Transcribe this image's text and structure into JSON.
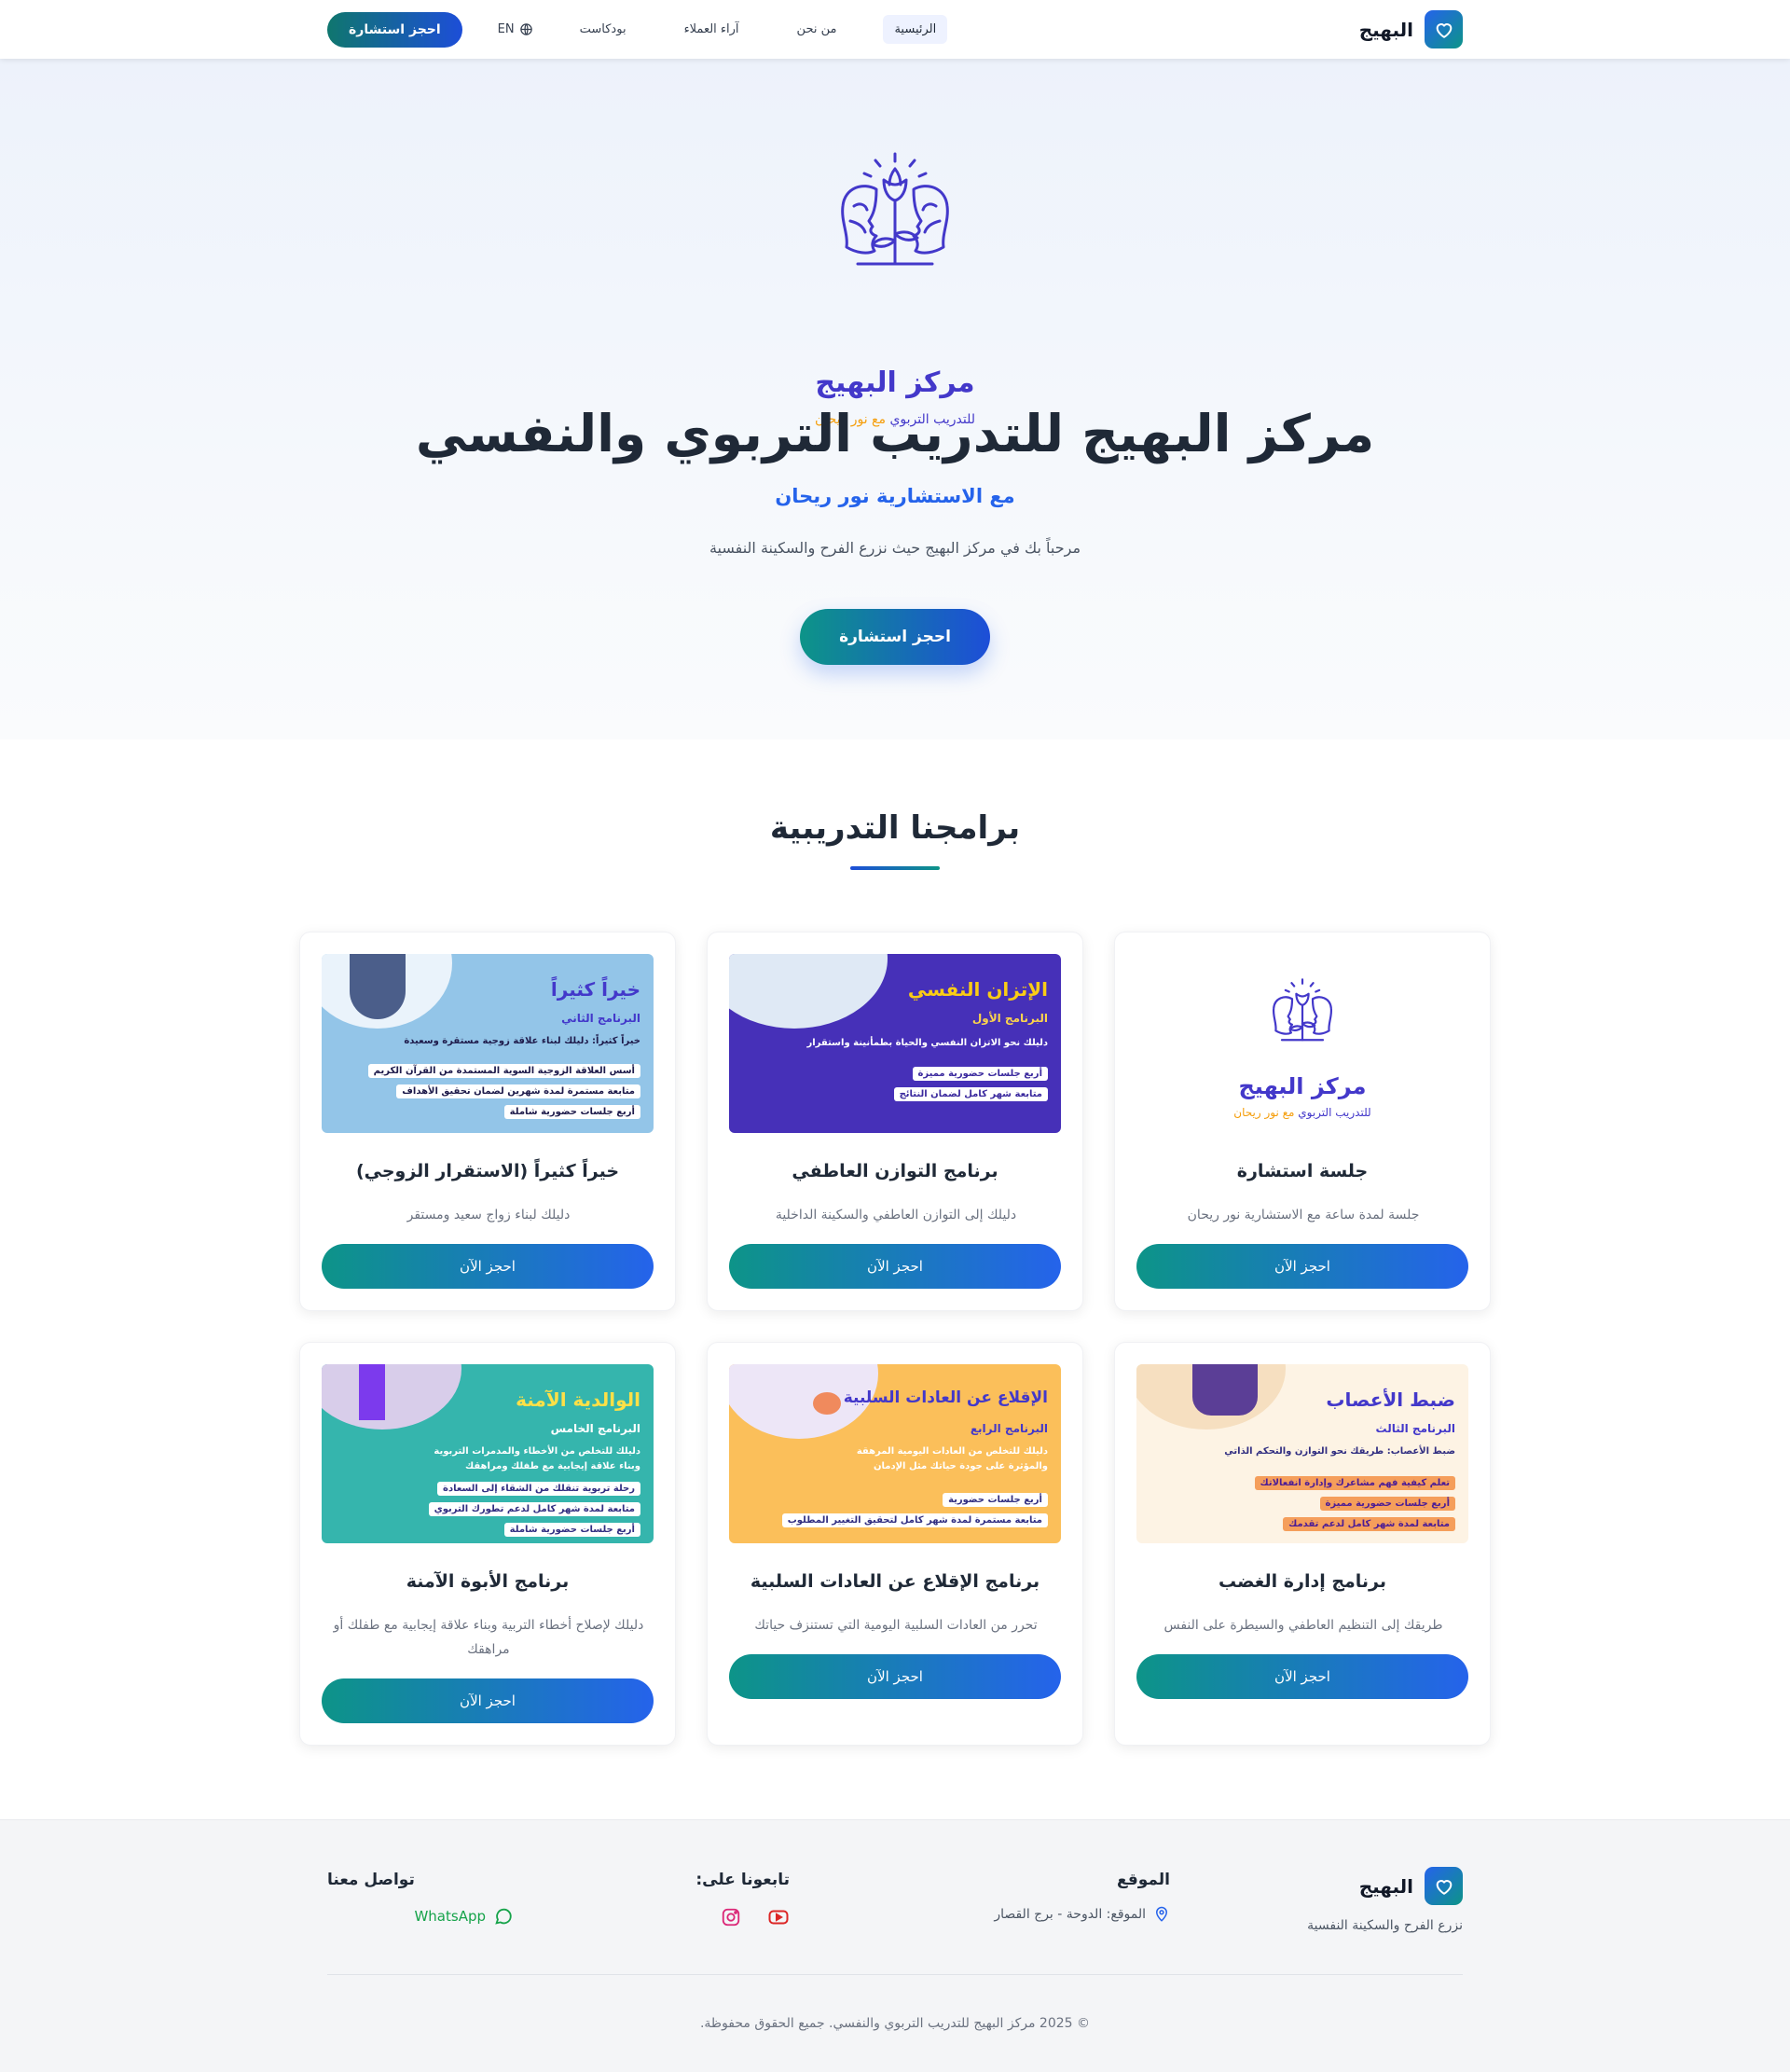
{
  "nav": {
    "brand": "البهيج",
    "items": [
      "الرئيسية",
      "من نحن",
      "آراء العملاء",
      "بودكاست"
    ],
    "lang": "EN",
    "cta": "احجز استشارة"
  },
  "hero": {
    "logo_title": "مركز البهيج",
    "logo_sub_main": "للتدريب التربوي",
    "logo_sub_accent": "مع نور ريحان",
    "title": "مركز البهيج للتدريب التربوي والنفسي",
    "subtitle": "مع الاستشارية نور ريحان",
    "description": "مرحباً بك في مركز البهيج حيث نزرع الفرح والسكينة النفسية",
    "cta": "احجز استشارة"
  },
  "programs": {
    "title": "برامجنا التدريبية",
    "book_label": "احجز الآن",
    "cards": [
      {
        "title": "جلسة استشارة",
        "desc": "جلسة لمدة ساعة مع الاستشارية نور ريحان"
      },
      {
        "title": "برنامج التوازن العاطفي",
        "desc": "دليلك إلى التوازن العاطفي والسكينة الداخلية",
        "poster": {
          "title": "الإتزان النفسي",
          "sub": "البرنامج الأول",
          "line": "دليلك نحو الاتزان النفسي والحياة بطمأنينة واستقرار",
          "chips": [
            "أربع جلسات حضورية مميزة",
            "متابعة شهر كامل لضمان النتائج"
          ]
        }
      },
      {
        "title": "خيراً كثيراً (الاستقرار الزوجي)",
        "desc": "دليلك لبناء زواج سعيد ومستقر",
        "poster": {
          "title": "خيراً كثيراً",
          "sub": "البرنامج الثاني",
          "line": "خيراً كثيراً: دليلك لبناء علاقة زوجية مستقرة وسعيدة",
          "chips": [
            "أسس العلاقة الزوجية السوية المستمدة من القرآن الكريم",
            "متابعة مستمرة لمدة شهرين لضمان تحقيق الأهداف",
            "أربع جلسات حضورية شاملة"
          ]
        }
      },
      {
        "title": "برنامج إدارة الغضب",
        "desc": "طريقك إلى التنظيم العاطفي والسيطرة على النفس",
        "poster": {
          "title": "ضبط الأعصاب",
          "sub": "البرنامج الثالث",
          "line": "ضبط الأعصاب: طريقك نحو التوازن والتحكم الذاتي",
          "chips": [
            "تعلم كيفية فهم مشاعرك وإدارة انفعالاتك",
            "أربع جلسات حضورية مميزة",
            "متابعة لمدة شهر كامل لدعم تقدمك"
          ]
        }
      },
      {
        "title": "برنامج الإقلاع عن العادات السلبية",
        "desc": "تحرر من العادات السلبية اليومية التي تستنزف حياتك",
        "poster": {
          "title": "الإقلاع عن العادات السلبية",
          "sub": "البرنامج الرابع",
          "line": "دليلك للتخلص من العادات اليومية المرهقة",
          "line2": "والمؤثرة على جودة حياتك مثل الإدمان",
          "chips": [
            "أربع جلسات حضورية",
            "متابعة مستمرة لمدة شهر كامل لتحقيق التغيير المطلوب"
          ]
        }
      },
      {
        "title": "برنامج الأبوة الآمنة",
        "desc": "دليلك لإصلاح أخطاء التربية وبناء علاقة إيجابية مع طفلك أو مراهقك",
        "poster": {
          "title": "الوالدية الآمنة",
          "sub": "البرنامج الخامس",
          "line": "دليلك للتخلص من الأخطاء والمدمرات التربوية",
          "line2": "وبناء علاقة إيجابية مع طفلك ومراهقك",
          "chips": [
            "رحلة تربوية تنقلك من الشقاء إلى السعادة",
            "متابعة لمدة شهر كامل لدعم تطورك التربوي",
            "أربع جلسات حضورية شاملة"
          ]
        }
      }
    ]
  },
  "footer": {
    "brand": "البهيج",
    "tagline": "نزرع الفرح والسكينة النفسية",
    "location_head": "الموقع",
    "location_text": "الموقع: الدوحة - برج القصار",
    "follow_head": "تابعونا على:",
    "contact_head": "تواصل معنا",
    "whatsapp": "WhatsApp",
    "copyright": "© 2025 مركز البهيج للتدريب التربوي والنفسي. جميع الحقوق محفوظة."
  },
  "colors": {
    "primary": "#2563eb",
    "teal": "#0d9488",
    "logo": "#4338ca",
    "accent": "#f59e0b"
  }
}
